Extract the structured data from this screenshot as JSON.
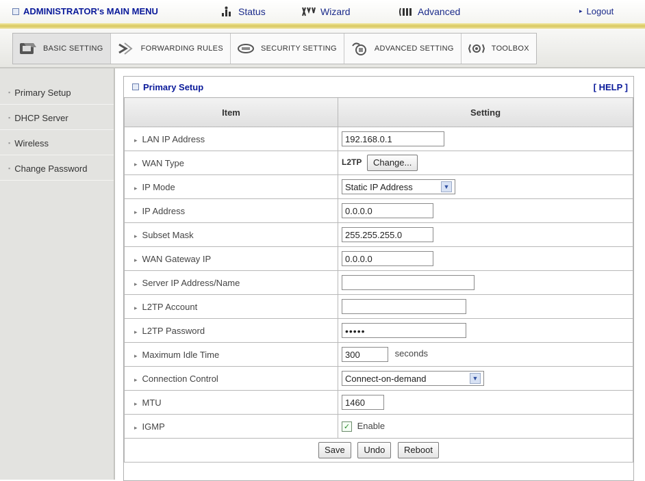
{
  "topbar": {
    "main_menu": "ADMINISTRATOR's MAIN MENU",
    "status": "Status",
    "wizard": "Wizard",
    "advanced": "Advanced",
    "logout": "Logout"
  },
  "tabs": [
    {
      "label": "BASIC SETTING",
      "icon": "basic-setting-icon",
      "active": true
    },
    {
      "label": "FORWARDING RULES",
      "icon": "forwarding-rules-icon",
      "active": false
    },
    {
      "label": "SECURITY SETTING",
      "icon": "security-setting-icon",
      "active": false
    },
    {
      "label": "ADVANCED SETTING",
      "icon": "advanced-setting-icon",
      "active": false
    },
    {
      "label": "TOOLBOX",
      "icon": "toolbox-icon",
      "active": false
    }
  ],
  "sidebar": {
    "items": [
      {
        "label": "Primary Setup"
      },
      {
        "label": "DHCP Server"
      },
      {
        "label": "Wireless"
      },
      {
        "label": "Change Password"
      }
    ]
  },
  "panel": {
    "title": "Primary Setup",
    "help": "[ HELP ]",
    "col_item": "Item",
    "col_setting": "Setting"
  },
  "rows": {
    "lan_ip": {
      "label": "LAN IP Address",
      "value": "192.168.0.1"
    },
    "wan_type": {
      "label": "WAN Type",
      "value": "L2TP",
      "button": "Change..."
    },
    "ip_mode": {
      "label": "IP Mode",
      "value": "Static IP Address"
    },
    "ip_address": {
      "label": "IP Address",
      "value": "0.0.0.0"
    },
    "subnet_mask": {
      "label": "Subset Mask",
      "value": "255.255.255.0"
    },
    "wan_gateway": {
      "label": "WAN Gateway IP",
      "value": "0.0.0.0"
    },
    "server_ip": {
      "label": "Server IP Address/Name",
      "value": ""
    },
    "l2tp_account": {
      "label": "L2TP Account",
      "value": ""
    },
    "l2tp_password": {
      "label": "L2TP Password",
      "value": "•••••"
    },
    "idle_time": {
      "label": "Maximum Idle Time",
      "value": "300",
      "unit": "seconds"
    },
    "connection_control": {
      "label": "Connection Control",
      "value": "Connect-on-demand"
    },
    "mtu": {
      "label": "MTU",
      "value": "1460"
    },
    "igmp": {
      "label": "IGMP",
      "checkbox_label": "Enable",
      "checked": true
    }
  },
  "buttons": {
    "save": "Save",
    "undo": "Undo",
    "reboot": "Reboot"
  }
}
